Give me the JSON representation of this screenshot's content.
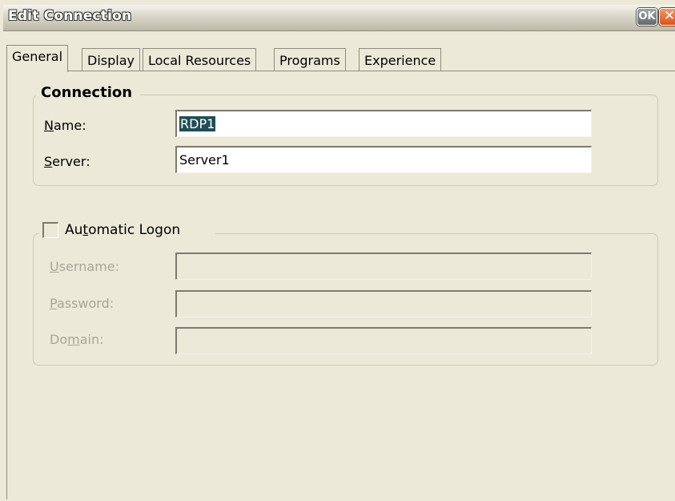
{
  "window": {
    "title": "Edit Connection",
    "ok_label": "OK",
    "close_glyph": "✕"
  },
  "tabs": [
    {
      "label": "General",
      "active": true
    },
    {
      "label": "Display"
    },
    {
      "label": "Local Resources"
    },
    {
      "label": "Programs"
    },
    {
      "label": "Experience"
    }
  ],
  "connection": {
    "legend": "Connection",
    "name_label": {
      "before": "",
      "key": "N",
      "after": "ame:"
    },
    "name_value": "RDP1",
    "server_label": {
      "before": "",
      "key": "S",
      "after": "erver:"
    },
    "server_value": "Server1"
  },
  "logon": {
    "checkbox_label": {
      "before": "Au",
      "key": "t",
      "after": "omatic Logon"
    },
    "checked": false,
    "username_label": {
      "before": "",
      "key": "U",
      "after": "sername:"
    },
    "username_value": "",
    "password_label": {
      "before": "",
      "key": "P",
      "after": "assword:"
    },
    "password_value": "",
    "domain_label": {
      "before": "Do",
      "key": "m",
      "after": "ain:"
    },
    "domain_value": ""
  }
}
